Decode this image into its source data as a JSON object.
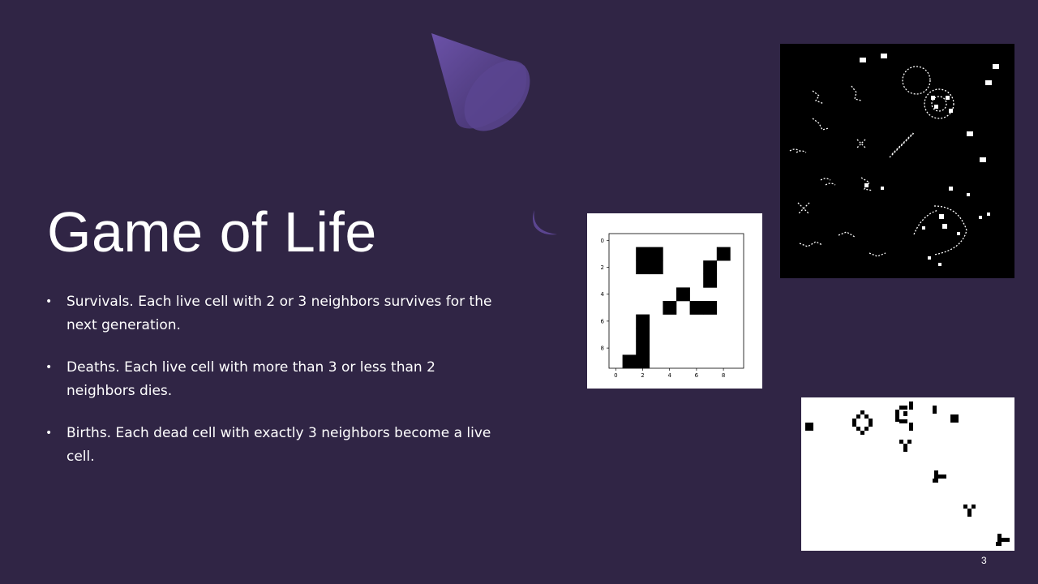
{
  "slide": {
    "title": "Game of Life",
    "bullets": [
      "Survivals. Each live cell with 2 or 3 neighbors survives for the next generation.",
      "Deaths. Each live cell with more than 3 or less than 2 neighbors dies.",
      "Births. Each dead cell with exactly 3 neighbors become a live cell."
    ],
    "page_number": "3"
  },
  "plot": {
    "x_ticks": [
      "0",
      "2",
      "4",
      "6",
      "8"
    ],
    "y_ticks": [
      "0",
      "2",
      "4",
      "6",
      "8"
    ],
    "grid_size": 10,
    "live_cells": [
      [
        2,
        1
      ],
      [
        3,
        1
      ],
      [
        2,
        2
      ],
      [
        3,
        2
      ],
      [
        8,
        1
      ],
      [
        7,
        2
      ],
      [
        7,
        3
      ],
      [
        5,
        4
      ],
      [
        4,
        5
      ],
      [
        6,
        5
      ],
      [
        7,
        5
      ],
      [
        2,
        6
      ],
      [
        2,
        7
      ],
      [
        2,
        8
      ],
      [
        1,
        9
      ],
      [
        2,
        9
      ]
    ]
  },
  "colors": {
    "background": "#302545",
    "text": "#ffffff",
    "accent": "#5b4590"
  }
}
